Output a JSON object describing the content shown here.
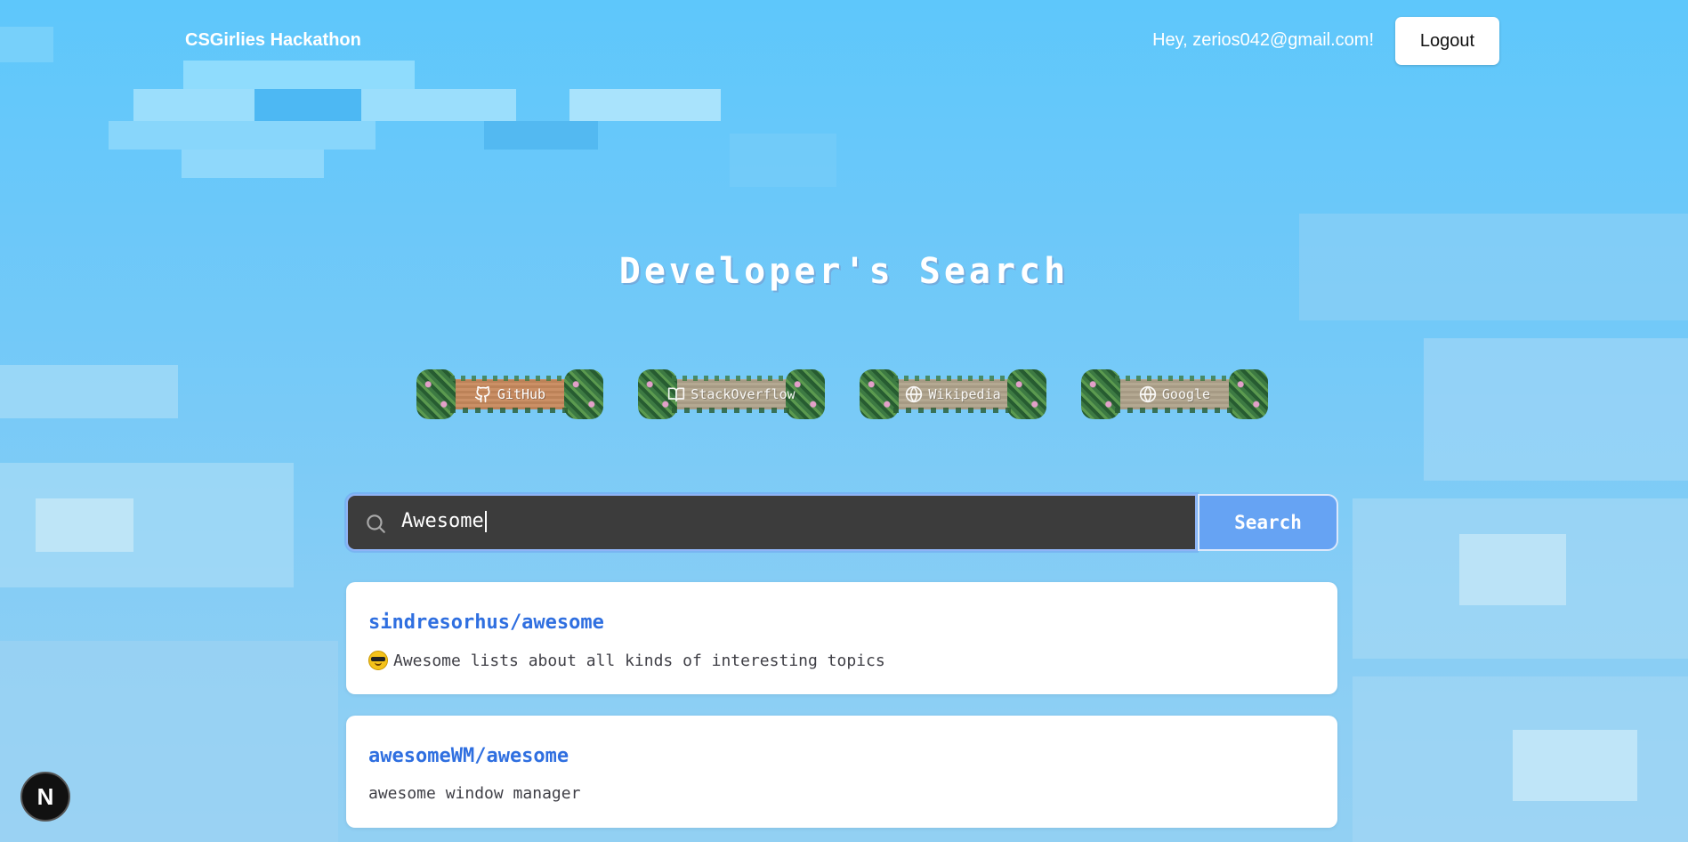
{
  "navbar": {
    "brand": "CSGirlies Hackathon",
    "greeting": "Hey, zerios042@gmail.com!",
    "logout_label": "Logout"
  },
  "page_title": "Developer's Search",
  "sources": [
    {
      "label": "GitHub",
      "icon": "github-icon",
      "active": true
    },
    {
      "label": "StackOverflow",
      "icon": "book-icon",
      "active": false
    },
    {
      "label": "Wikipedia",
      "icon": "globe-icon",
      "active": false
    },
    {
      "label": "Google",
      "icon": "globe-icon",
      "active": false
    }
  ],
  "search": {
    "value": "Awesome",
    "button_label": "Search"
  },
  "results": [
    {
      "title": "sindresorhus/awesome",
      "description": "Awesome lists about all kinds of interesting topics",
      "emoji": "sunglasses-emoji"
    },
    {
      "title": "awesomeWM/awesome",
      "description": "awesome window manager",
      "emoji": ""
    }
  ],
  "dev_badge": "N",
  "colors": {
    "sky": "#7cc8f6",
    "search_field": "#3c3c3c",
    "search_button": "#66a3f3",
    "link": "#2f6fe0",
    "active_sign": "#c88a5e",
    "inactive_sign": "#b0a48c"
  }
}
